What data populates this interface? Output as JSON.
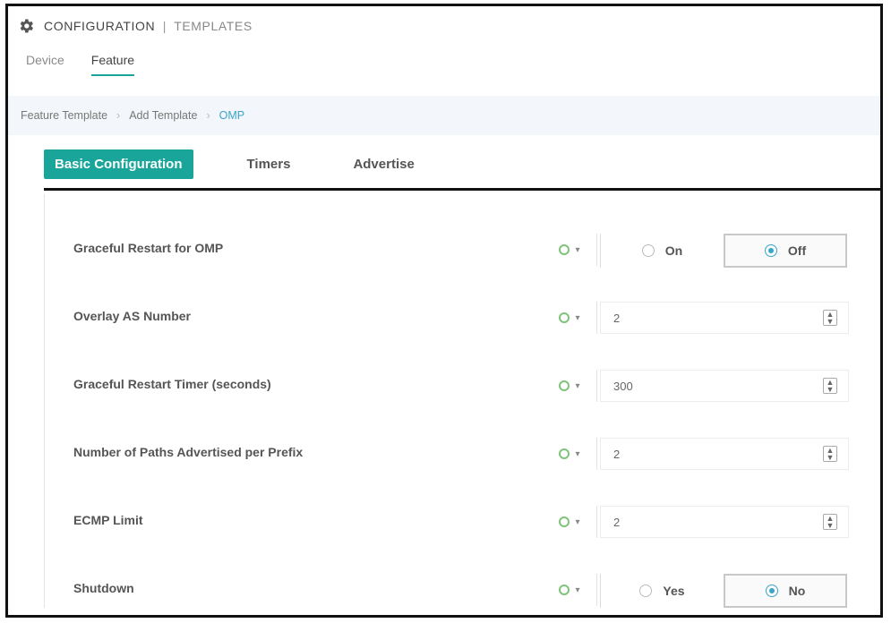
{
  "header": {
    "title": "CONFIGURATION",
    "separator": "|",
    "subtitle": "TEMPLATES",
    "icon": "gear-icon"
  },
  "top_tabs": [
    {
      "label": "Device",
      "active": false
    },
    {
      "label": "Feature",
      "active": true
    }
  ],
  "breadcrumb": [
    {
      "label": "Feature Template"
    },
    {
      "label": "Add Template"
    },
    {
      "label": "OMP"
    }
  ],
  "breadcrumb_separator": "›",
  "sub_tabs": [
    {
      "label": "Basic Configuration",
      "active": true
    },
    {
      "label": "Timers",
      "active": false
    },
    {
      "label": "Advertise",
      "active": false
    }
  ],
  "fields": [
    {
      "label": "Graceful Restart for OMP",
      "type": "radio",
      "options": [
        "On",
        "Off"
      ],
      "selected": "Off"
    },
    {
      "label": "Overlay AS Number",
      "type": "number",
      "value": "2"
    },
    {
      "label": "Graceful Restart Timer (seconds)",
      "type": "number",
      "value": "300"
    },
    {
      "label": "Number of Paths Advertised per Prefix",
      "type": "number",
      "value": "2"
    },
    {
      "label": "ECMP Limit",
      "type": "number",
      "value": "2"
    },
    {
      "label": "Shutdown",
      "type": "radio",
      "options": [
        "Yes",
        "No"
      ],
      "selected": "No"
    }
  ],
  "scope_caret": "▾",
  "colors": {
    "accent": "#1aa59a",
    "link": "#3aa5c9",
    "scope_default": "#7ec37a"
  }
}
